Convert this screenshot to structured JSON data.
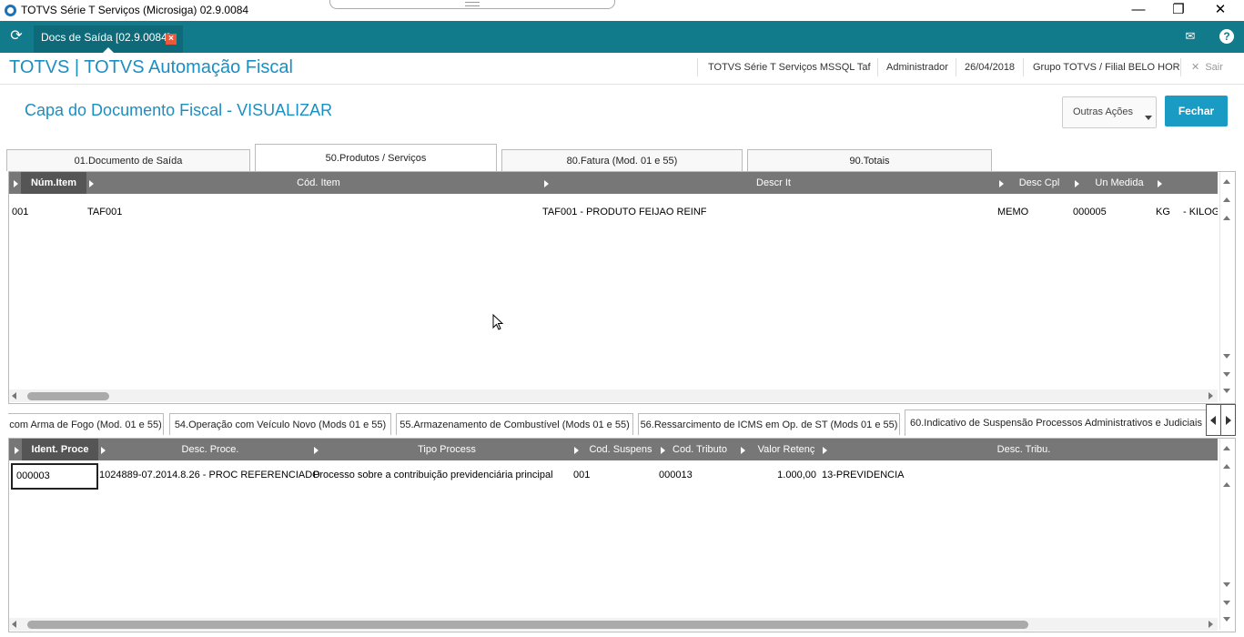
{
  "window": {
    "title": "TOTVS Série T Serviços (Microsiga) 02.9.0084",
    "minimize": "—",
    "maximize": "❐",
    "close": "✕"
  },
  "tabbar": {
    "active_tab": "Docs de Saída [02.9.0084]",
    "close_icon": "×",
    "mail_icon": "✉",
    "help_icon": "?"
  },
  "header": {
    "app_title": "TOTVS | TOTVS Automação Fiscal",
    "environment": "TOTVS Série T Serviços MSSQL Taf",
    "user": "Administrador",
    "date": "26/04/2018",
    "branch": "Grupo TOTVS / Filial BELO HOR",
    "exit_label": "Sair",
    "exit_icon": "✕"
  },
  "page": {
    "title": "Capa do Documento Fiscal - VISUALIZAR",
    "other_actions": "Outras Ações",
    "close_button": "Fechar"
  },
  "tabs": [
    {
      "label": "01.Documento de Saída",
      "active": false
    },
    {
      "label": "50.Produtos / Serviços",
      "active": true
    },
    {
      "label": "80.Fatura (Mod. 01 e 55)",
      "active": false
    },
    {
      "label": "90.Totais",
      "active": false
    }
  ],
  "products_grid": {
    "columns": [
      "Núm.Item",
      "Cód. Item",
      "Descr It",
      "Desc Cpl",
      "Un Medida",
      ""
    ],
    "rows": [
      [
        "001",
        "TAF001",
        "TAF001 - PRODUTO FEIJAO REINF",
        "MEMO",
        "000005",
        "KG",
        "- KILOG"
      ]
    ]
  },
  "sub_tabs": [
    {
      "label": "com Arma de Fogo (Mod. 01 e 55)",
      "active": false
    },
    {
      "label": "54.Operação com Veículo Novo (Mods 01 e 55)",
      "active": false
    },
    {
      "label": "55.Armazenamento de Combustível (Mods 01 e 55)",
      "active": false
    },
    {
      "label": "56.Ressarcimento de ICMS em Op. de ST (Mods 01 e 55)",
      "active": false
    },
    {
      "label": "60.Indicativo de Suspensão Processos Administrativos e Judiciais",
      "active": true
    }
  ],
  "process_grid": {
    "columns": [
      "Ident. Proce",
      "Desc. Proce.",
      "Tipo Process",
      "Cod. Suspens",
      "Cod. Tributo",
      "Valor Retenç",
      "Desc. Tribu."
    ],
    "rows": [
      [
        "000003",
        "1024889-07.2014.8.26 - PROC REFERENCIADO",
        "Processo sobre a contribuição previdenciária principal",
        "001",
        "000013",
        "1.000,00",
        "13-PREVIDENCIA"
      ]
    ]
  }
}
